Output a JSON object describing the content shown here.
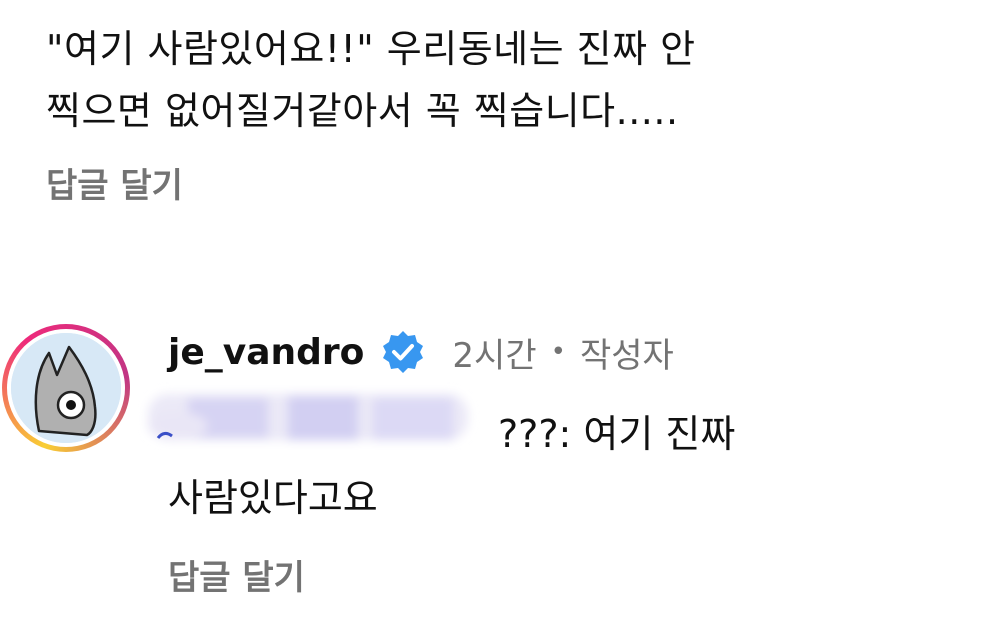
{
  "top_comment": {
    "text_line1": "\"여기 사람있어요!!\" 우리동네는 진짜 안",
    "text_line2": "찍으면 없어질거같아서 꼭 찍습니다.....",
    "reply_label": "답글 달기"
  },
  "reply": {
    "username": "je_vandro",
    "verified_icon": "verified-badge-icon",
    "time": "2시간",
    "separator": "•",
    "author_tag": "작성자",
    "text_line1": "???: 여기 진짜",
    "text_line2": "사람있다고요",
    "reply_label": "답글 달기"
  },
  "colors": {
    "text_primary": "#111111",
    "text_secondary": "#737373",
    "verified_blue": "#3897f0",
    "ring_yellow": "#f9ce34",
    "ring_pink": "#ee2a7b",
    "ring_purple": "#c13584",
    "redaction_lavender": "#d9d6f5"
  }
}
